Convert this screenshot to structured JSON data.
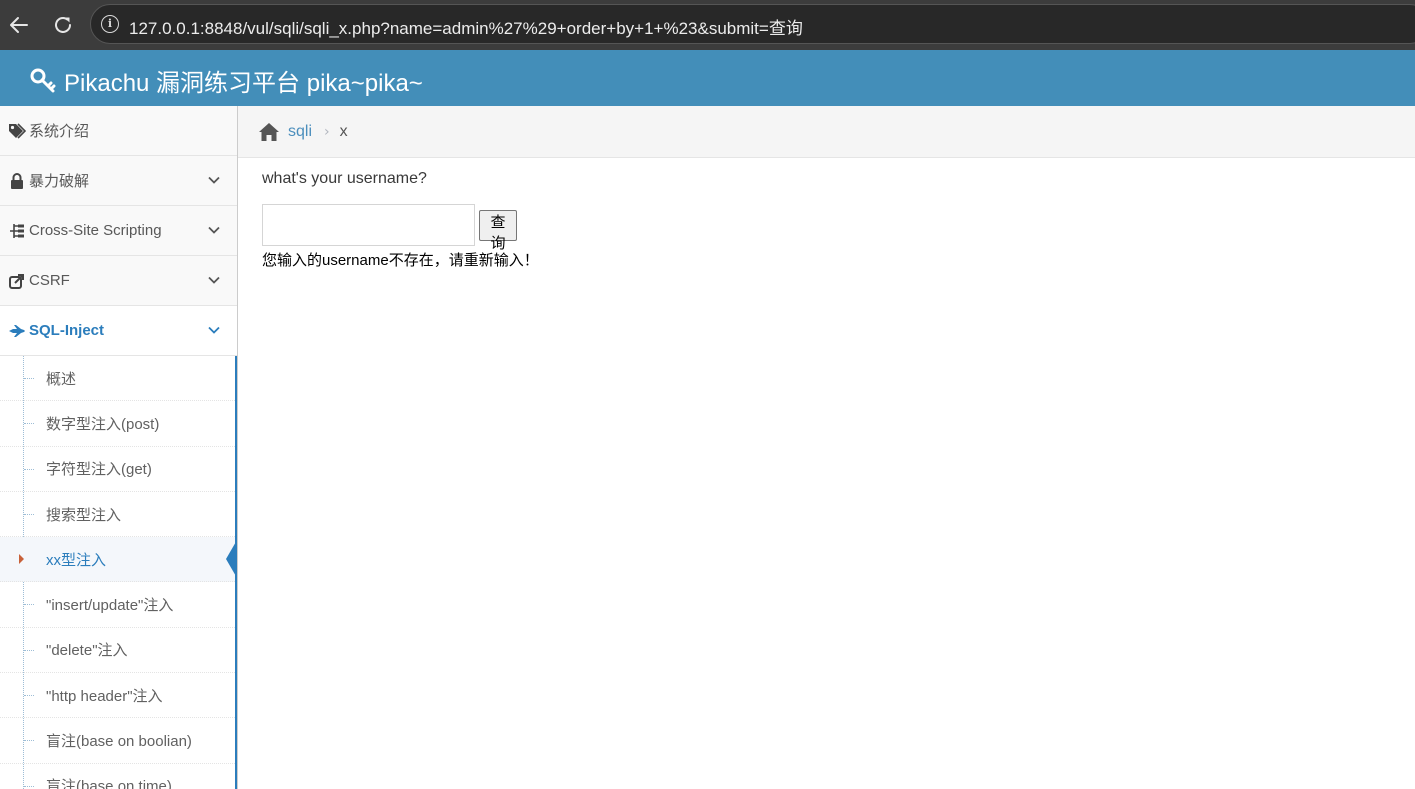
{
  "browser": {
    "url": "127.0.0.1:8848/vul/sqli/sqli_x.php?name=admin%27%29+order+by+1+%23&submit=查询"
  },
  "header": {
    "title": "Pikachu 漏洞练习平台 pika~pika~",
    "icon": "key-icon"
  },
  "sidebar": {
    "items": [
      {
        "label": "系统介绍",
        "icon": "tags-icon"
      },
      {
        "label": "暴力破解",
        "icon": "lock-icon"
      },
      {
        "label": "Cross-Site Scripting",
        "icon": "sitemap-icon"
      },
      {
        "label": "CSRF",
        "icon": "share-icon"
      },
      {
        "label": "SQL-Inject",
        "icon": "fighter-jet-icon"
      }
    ],
    "sub_items": [
      {
        "label": "概述"
      },
      {
        "label": "数字型注入(post)"
      },
      {
        "label": "字符型注入(get)"
      },
      {
        "label": "搜索型注入"
      },
      {
        "label": "xx型注入"
      },
      {
        "label": "\"insert/update\"注入"
      },
      {
        "label": "\"delete\"注入"
      },
      {
        "label": "\"http header\"注入"
      },
      {
        "label": "盲注(base on boolian)"
      },
      {
        "label": "盲注(base on time)"
      }
    ]
  },
  "breadcrumb": {
    "home": "sqli",
    "current": "x"
  },
  "main": {
    "prompt": "what's your username?",
    "input_value": "",
    "submit_label": "查询",
    "result_text": "您输入的username不存在，请重新输入！"
  },
  "colors": {
    "header_bg": "#438eb9",
    "accent": "#2b7dbc",
    "link": "#4c8fbd"
  }
}
